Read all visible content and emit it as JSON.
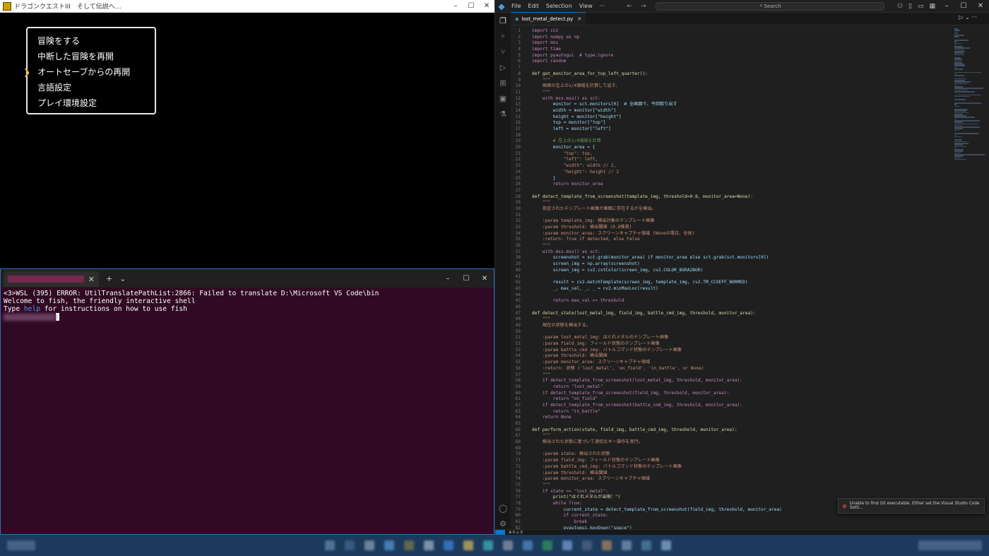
{
  "game": {
    "title": "ドラゴンクエストIII　そして伝説へ…",
    "menu": [
      {
        "label": "冒険をする"
      },
      {
        "label": "中断した冒険を再開"
      },
      {
        "label": "オートセーブからの再開",
        "selected": true
      },
      {
        "label": "言語設定"
      },
      {
        "label": "プレイ環境設定"
      }
    ],
    "cursor_glyph": "❯"
  },
  "terminal": {
    "lines": [
      "<3>WSL (395) ERROR: UtilTranslatePathList:2866: Failed to translate D:\\Microsoft VS Code\\bin",
      "Welcome to fish, the friendly interactive shell"
    ],
    "help_before": "Type ",
    "help_link": "help",
    "help_after": " for instructions on how to use fish"
  },
  "vscode": {
    "menus": [
      "File",
      "Edit",
      "Selection",
      "View",
      "···"
    ],
    "search_placeholder": "Search",
    "tab_label": "lost_metal_detect.py",
    "notification": "Unable to find Git executable. Either set the Visual Studio Code Setti...",
    "code": [
      {
        "t": "import cv2",
        "c": "kw"
      },
      {
        "t": "import numpy as np",
        "c": "kw"
      },
      {
        "t": "import mss",
        "c": "kw"
      },
      {
        "t": "import time",
        "c": "kw"
      },
      {
        "t": "import pyautogui  # type:ignore",
        "c": "kw"
      },
      {
        "t": "import random",
        "c": "kw"
      },
      {
        "t": "",
        "c": ""
      },
      {
        "t": "def get_monitor_area_for_top_left_quarter():",
        "c": "def"
      },
      {
        "t": "    \"\"\"",
        "c": "str"
      },
      {
        "t": "    画面の左上の1/4領域を計算して返す。",
        "c": "ja"
      },
      {
        "t": "    \"\"\"",
        "c": "str"
      },
      {
        "t": "    with mss.mss() as sct:",
        "c": "kw"
      },
      {
        "t": "        monitor = sct.monitors[0]  # 全画面で、今回取り出す",
        "c": ""
      },
      {
        "t": "        width = monitor[\"width\"]",
        "c": ""
      },
      {
        "t": "        height = monitor[\"height\"]",
        "c": ""
      },
      {
        "t": "        top = monitor[\"top\"]",
        "c": ""
      },
      {
        "t": "        left = monitor[\"left\"]",
        "c": ""
      },
      {
        "t": "",
        "c": ""
      },
      {
        "t": "        # 左上の1/4領域を計算",
        "c": "cm"
      },
      {
        "t": "        monitor_area = {",
        "c": ""
      },
      {
        "t": "            \"top\": top,",
        "c": "str"
      },
      {
        "t": "            \"left\": left,",
        "c": "str"
      },
      {
        "t": "            \"width\": width // 2,",
        "c": "str"
      },
      {
        "t": "            \"height\": height // 2",
        "c": "str"
      },
      {
        "t": "        }",
        "c": ""
      },
      {
        "t": "        return monitor_area",
        "c": "kw"
      },
      {
        "t": "",
        "c": ""
      },
      {
        "t": "def detect_template_from_screenshot(template_img, threshold=0.8, monitor_area=None):",
        "c": "def"
      },
      {
        "t": "    \"\"\"",
        "c": "str"
      },
      {
        "t": "    指定されたテンプレート画像が画面に存在するかを検出。",
        "c": "ja"
      },
      {
        "t": "",
        "c": ""
      },
      {
        "t": "    :param template_img: 検出対象のテンプレート画像",
        "c": "str"
      },
      {
        "t": "    :param threshold: 検出閾値 (0.8推奨)",
        "c": "str"
      },
      {
        "t": "    :param monitor_area: スクリーンキャプチャ領域 (Noneの場合、全体)",
        "c": "str"
      },
      {
        "t": "    :return: True if detected, else False",
        "c": "str"
      },
      {
        "t": "    \"\"\"",
        "c": "str"
      },
      {
        "t": "    with mss.mss() as sct:",
        "c": "kw"
      },
      {
        "t": "        screenshot = sct.grab(monitor_area) if monitor_area else sct.grab(sct.monitors[0])",
        "c": ""
      },
      {
        "t": "        screen_img = np.array(screenshot)",
        "c": ""
      },
      {
        "t": "        screen_img = cv2.cvtColor(screen_img, cv2.COLOR_BGRA2BGR)",
        "c": ""
      },
      {
        "t": "",
        "c": ""
      },
      {
        "t": "        result = cv2.matchTemplate(screen_img, template_img, cv2.TM_CCOEFF_NORMED)",
        "c": ""
      },
      {
        "t": "        _, max_val, _, _ = cv2.minMaxLoc(result)",
        "c": ""
      },
      {
        "t": "",
        "c": ""
      },
      {
        "t": "        return max_val >= threshold",
        "c": "kw"
      },
      {
        "t": "",
        "c": ""
      },
      {
        "t": "def detect_state(lost_metal_img, field_img, battle_cmd_img, threshold, monitor_area):",
        "c": "def"
      },
      {
        "t": "    \"\"\"",
        "c": "str"
      },
      {
        "t": "    現在の状態を検出する。",
        "c": "ja"
      },
      {
        "t": "",
        "c": ""
      },
      {
        "t": "    :param lost_metal_img: はぐれメタルのテンプレート画像",
        "c": "str"
      },
      {
        "t": "    :param field_img: フィールド状態のテンプレート画像",
        "c": "str"
      },
      {
        "t": "    :param battle_cmd_img: バトルコマンド状態のテンプレート画像",
        "c": "str"
      },
      {
        "t": "    :param threshold: 検出閾値",
        "c": "str"
      },
      {
        "t": "    :param monitor_area: スクリーンキャプチャ領域",
        "c": "str"
      },
      {
        "t": "    :return: 状態 ('lost_metal', 'on_field', 'in_battle', or None)",
        "c": "str"
      },
      {
        "t": "    \"\"\"",
        "c": "str"
      },
      {
        "t": "    if detect_template_from_screenshot(lost_metal_img, threshold, monitor_area):",
        "c": "kw"
      },
      {
        "t": "        return \"lost_metal\"",
        "c": "kw"
      },
      {
        "t": "    if detect_template_from_screenshot(field_img, threshold, monitor_area):",
        "c": "kw"
      },
      {
        "t": "        return \"on_field\"",
        "c": "kw"
      },
      {
        "t": "    if detect_template_from_screenshot(battle_cmd_img, threshold, monitor_area):",
        "c": "kw"
      },
      {
        "t": "        return \"in_battle\"",
        "c": "kw"
      },
      {
        "t": "    return None",
        "c": "kw"
      },
      {
        "t": "",
        "c": ""
      },
      {
        "t": "def perform_action(state, field_img, battle_cmd_img, threshold, monitor_area):",
        "c": "def"
      },
      {
        "t": "    \"\"\"",
        "c": "str"
      },
      {
        "t": "    検出された状態に基づいて適切なキー操作を実行。",
        "c": "ja"
      },
      {
        "t": "",
        "c": ""
      },
      {
        "t": "    :param state: 検出された状態",
        "c": "str"
      },
      {
        "t": "    :param field_img: フィールド状態のテンプレート画像",
        "c": "str"
      },
      {
        "t": "    :param battle_cmd_img: バトルコマンド状態のテンプレート画像",
        "c": "str"
      },
      {
        "t": "    :param threshold: 検出閾値",
        "c": "str"
      },
      {
        "t": "    :param monitor_area: スクリーンキャプチャ領域",
        "c": "str"
      },
      {
        "t": "    \"\"\"",
        "c": "str"
      },
      {
        "t": "    if state == \"lost_metal\":",
        "c": "kw"
      },
      {
        "t": "        print(\"はぐれメタルが出現！\")",
        "c": "def"
      },
      {
        "t": "        while True:",
        "c": "kw"
      },
      {
        "t": "            current_state = detect_template_from_screenshot(field_img, threshold, monitor_area)",
        "c": ""
      },
      {
        "t": "            if current_state:",
        "c": "kw"
      },
      {
        "t": "                break",
        "c": "kw"
      },
      {
        "t": "            pyautogui.keyDown(\"space\")",
        "c": ""
      }
    ]
  },
  "colors": {
    "terminal_bg": "#300a24",
    "vscode_bg": "#1f1f1f",
    "game_bg": "#000000",
    "accent": "#0078d4"
  }
}
